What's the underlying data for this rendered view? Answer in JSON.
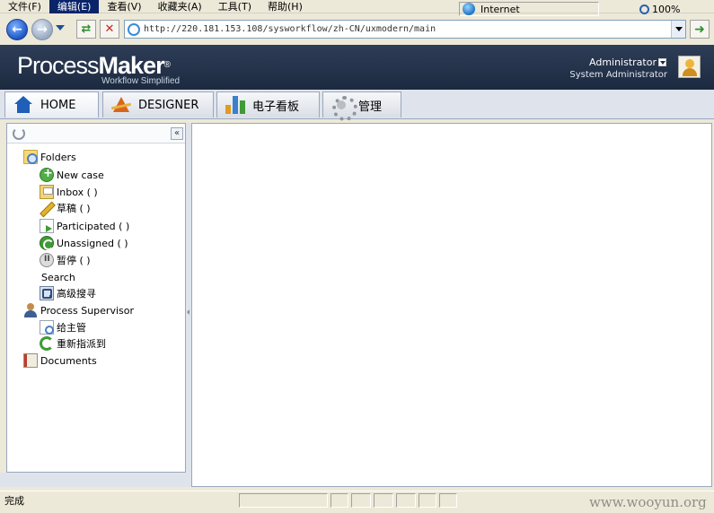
{
  "browser": {
    "menu": [
      "文件(F)",
      "编辑(E)",
      "查看(V)",
      "收藏夹(A)",
      "工具(T)",
      "帮助(H)"
    ],
    "active_menu_index": 1,
    "address_url": "http://220.181.153.108/sysworkflow/zh-CN/uxmodern/main"
  },
  "header": {
    "logo_regular": "Process",
    "logo_bold": "Maker",
    "logo_mark": "®",
    "tagline": "Workflow Simplified",
    "user_name": "Administrator",
    "user_role": "System Administrator"
  },
  "tabs": [
    {
      "label": "HOME",
      "icon": "home-icon"
    },
    {
      "label": "DESIGNER",
      "icon": "designer-icon"
    },
    {
      "label": "电子看板",
      "icon": "dashboard-icon"
    },
    {
      "label": "管理",
      "icon": "gear-icon"
    }
  ],
  "sidebar": {
    "items": [
      {
        "label": "Folders",
        "icon": "folders-icon"
      },
      {
        "label": "New case",
        "icon": "new-case-icon"
      },
      {
        "label": "Inbox ( )",
        "icon": "inbox-icon"
      },
      {
        "label": "草稿 ( )",
        "icon": "draft-icon"
      },
      {
        "label": "Participated ( )",
        "icon": "participated-icon"
      },
      {
        "label": "Unassigned ( )",
        "icon": "unassigned-icon"
      },
      {
        "label": "暂停 ( )",
        "icon": "paused-icon"
      },
      {
        "label": "Search",
        "icon": ""
      },
      {
        "label": "高级搜寻",
        "icon": "advanced-search-icon"
      },
      {
        "label": "Process Supervisor",
        "icon": "supervisor-icon"
      },
      {
        "label": "给主管",
        "icon": "to-supervisor-icon"
      },
      {
        "label": "重新指派到",
        "icon": "reassign-icon"
      },
      {
        "label": "Documents",
        "icon": "documents-icon"
      }
    ]
  },
  "statusbar": {
    "status": "完成",
    "zone": "Internet",
    "zoom": "100%"
  },
  "watermark": "www.wooyun.org"
}
